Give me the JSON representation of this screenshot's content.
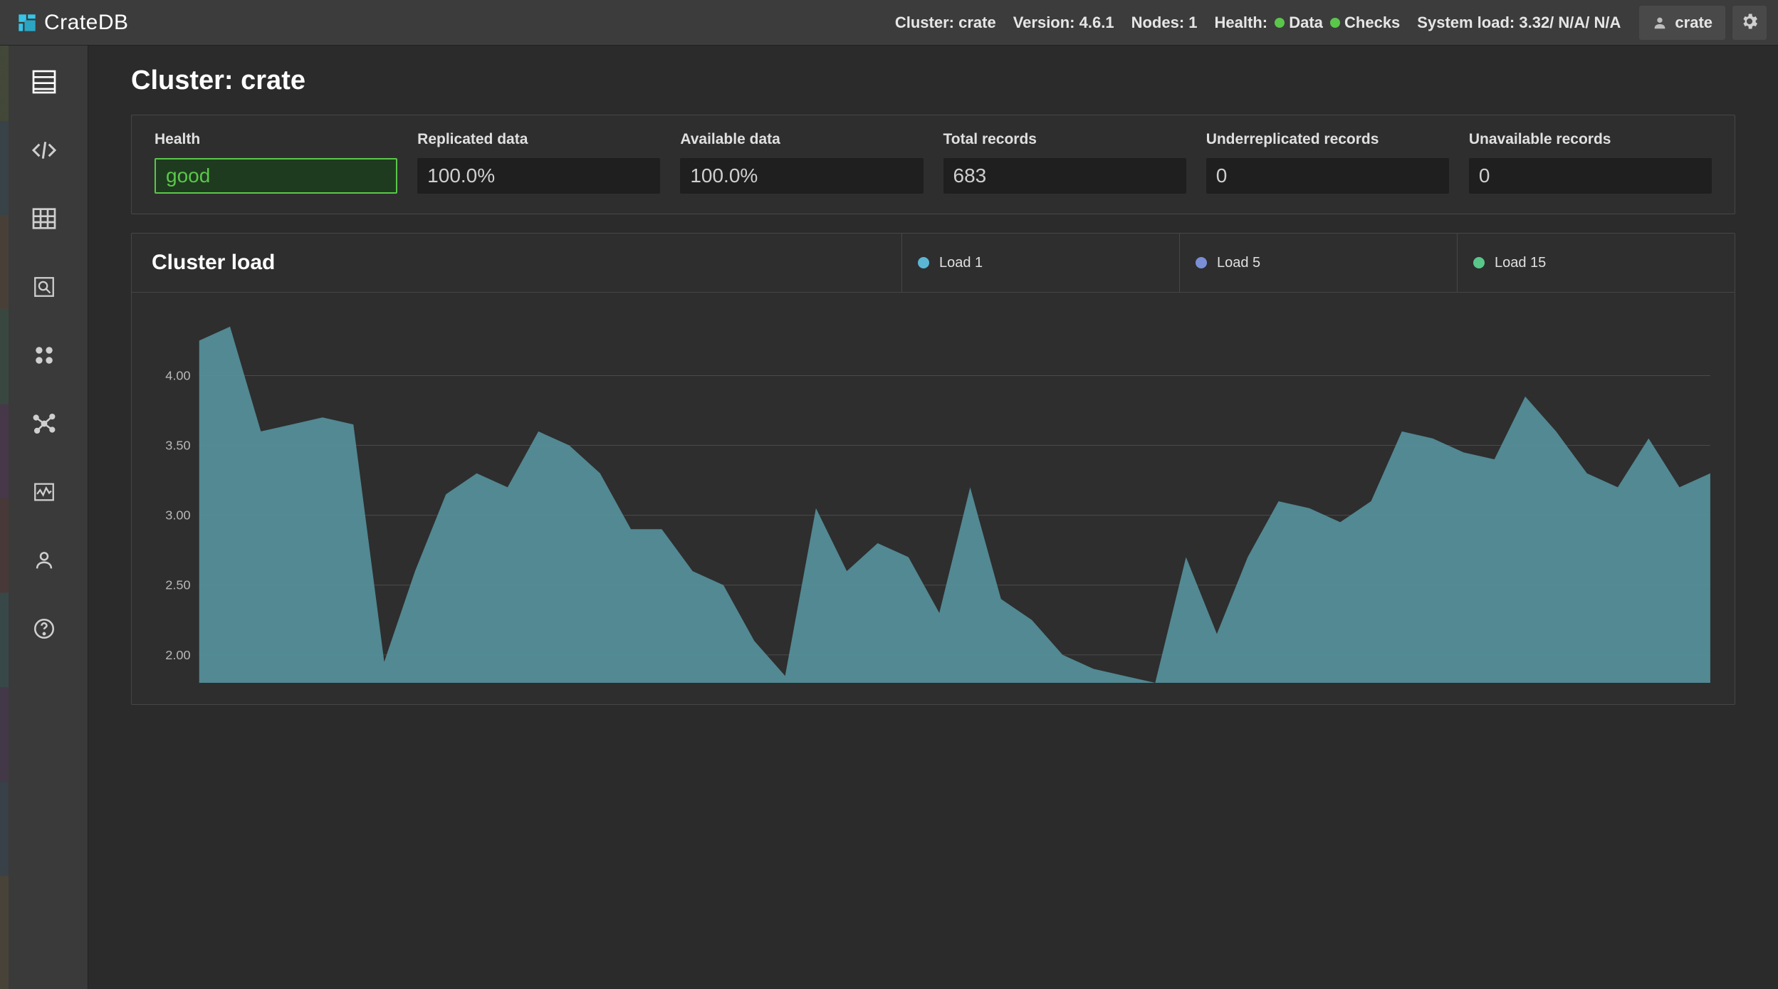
{
  "brand": {
    "name": "CrateDB"
  },
  "topbar": {
    "cluster_label": "Cluster:",
    "cluster_name": "crate",
    "version_label": "Version:",
    "version_value": "4.6.1",
    "nodes_label": "Nodes:",
    "nodes_value": "1",
    "health_label": "Health:",
    "health_data": "Data",
    "health_checks": "Checks",
    "sysload_label": "System load:",
    "sysload_value": "3.32/ N/A/ N/A",
    "username": "crate"
  },
  "page": {
    "title": "Cluster: crate"
  },
  "metrics": {
    "health": {
      "label": "Health",
      "value": "good"
    },
    "replicated": {
      "label": "Replicated data",
      "value": "100.0%"
    },
    "available": {
      "label": "Available data",
      "value": "100.0%"
    },
    "total_records": {
      "label": "Total records",
      "value": "683"
    },
    "underreplicated": {
      "label": "Underreplicated records",
      "value": "0"
    },
    "unavailable": {
      "label": "Unavailable records",
      "value": "0"
    }
  },
  "load_panel": {
    "title": "Cluster load",
    "legend": {
      "load1": {
        "label": "Load 1",
        "color": "#5bb6d4"
      },
      "load5": {
        "label": "Load 5",
        "color": "#7a8fd6"
      },
      "load15": {
        "label": "Load 15",
        "color": "#5ac78a"
      }
    }
  },
  "chart_data": {
    "type": "area",
    "title": "Cluster load",
    "xlabel": "",
    "ylabel": "",
    "ylim": [
      1.8,
      4.4
    ],
    "yticks": [
      2.0,
      2.5,
      3.0,
      3.5,
      4.0
    ],
    "series": [
      {
        "name": "Load 1",
        "color": "#57949f",
        "values": [
          4.25,
          4.35,
          3.6,
          3.65,
          3.7,
          3.65,
          1.95,
          2.6,
          3.15,
          3.3,
          3.2,
          3.6,
          3.5,
          3.3,
          2.9,
          2.9,
          2.6,
          2.5,
          2.1,
          1.85,
          3.05,
          2.6,
          2.8,
          2.7,
          2.3,
          3.2,
          2.4,
          2.25,
          2.0,
          1.9,
          1.85,
          1.8,
          2.7,
          2.15,
          2.7,
          3.1,
          3.05,
          2.95,
          3.1,
          3.6,
          3.55,
          3.45,
          3.4,
          3.85,
          3.6,
          3.3,
          3.2,
          3.55,
          3.2,
          3.3
        ]
      }
    ]
  }
}
